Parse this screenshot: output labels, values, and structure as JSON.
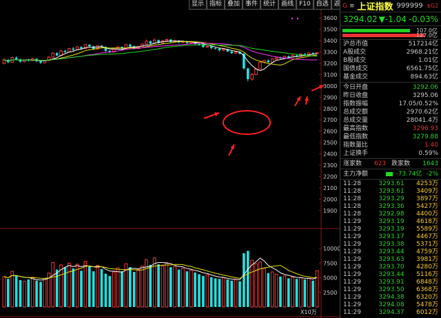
{
  "toolbar": {
    "items": [
      "显示",
      "指标",
      "叠加",
      "事件",
      "统计",
      "画线",
      "F10",
      "自选",
      "返回"
    ]
  },
  "chart": {
    "price_ticks": [
      "3600",
      "3500",
      "3400",
      "3300",
      "3200",
      "3100",
      "3000",
      "2900",
      "2800",
      "2700",
      "2600",
      "2500",
      "2400",
      "2300",
      "2200",
      "2100",
      "2000",
      "1900"
    ],
    "volume_ticks": [
      "10000",
      "7500",
      "5000",
      "2500"
    ],
    "volume_unit": "X10万"
  },
  "chart_data": {
    "type": "candlestick",
    "ylim": [
      1850,
      3650
    ],
    "candles": [
      {
        "o": 3200,
        "c": 3230,
        "h": 3245,
        "l": 3190
      },
      {
        "o": 3230,
        "c": 3210,
        "h": 3240,
        "l": 3200
      },
      {
        "o": 3210,
        "c": 3250,
        "h": 3260,
        "l": 3205
      },
      {
        "o": 3250,
        "c": 3235,
        "h": 3262,
        "l": 3225
      },
      {
        "o": 3235,
        "c": 3215,
        "h": 3240,
        "l": 3205
      },
      {
        "o": 3215,
        "c": 3230,
        "h": 3235,
        "l": 3208
      },
      {
        "o": 3230,
        "c": 3225,
        "h": 3238,
        "l": 3215
      },
      {
        "o": 3225,
        "c": 3240,
        "h": 3248,
        "l": 3218
      },
      {
        "o": 3240,
        "c": 3220,
        "h": 3245,
        "l": 3210
      },
      {
        "o": 3220,
        "c": 3205,
        "h": 3228,
        "l": 3195
      },
      {
        "o": 3205,
        "c": 3225,
        "h": 3232,
        "l": 3198
      },
      {
        "o": 3225,
        "c": 3255,
        "h": 3262,
        "l": 3220
      },
      {
        "o": 3255,
        "c": 3290,
        "h": 3300,
        "l": 3250
      },
      {
        "o": 3290,
        "c": 3270,
        "h": 3298,
        "l": 3262
      },
      {
        "o": 3270,
        "c": 3310,
        "h": 3318,
        "l": 3265
      },
      {
        "o": 3310,
        "c": 3300,
        "h": 3320,
        "l": 3292
      },
      {
        "o": 3300,
        "c": 3330,
        "h": 3338,
        "l": 3295
      },
      {
        "o": 3330,
        "c": 3320,
        "h": 3345,
        "l": 3310
      },
      {
        "o": 3320,
        "c": 3345,
        "h": 3352,
        "l": 3315
      },
      {
        "o": 3345,
        "c": 3330,
        "h": 3350,
        "l": 3320
      },
      {
        "o": 3330,
        "c": 3365,
        "h": 3372,
        "l": 3326
      },
      {
        "o": 3365,
        "c": 3350,
        "h": 3370,
        "l": 3340
      },
      {
        "o": 3350,
        "c": 3325,
        "h": 3355,
        "l": 3318
      },
      {
        "o": 3325,
        "c": 3355,
        "h": 3360,
        "l": 3320
      },
      {
        "o": 3355,
        "c": 3345,
        "h": 3362,
        "l": 3335
      },
      {
        "o": 3345,
        "c": 3310,
        "h": 3350,
        "l": 3300
      },
      {
        "o": 3310,
        "c": 3300,
        "h": 3318,
        "l": 3290
      },
      {
        "o": 3300,
        "c": 3325,
        "h": 3330,
        "l": 3295
      },
      {
        "o": 3325,
        "c": 3345,
        "h": 3352,
        "l": 3320
      },
      {
        "o": 3345,
        "c": 3330,
        "h": 3350,
        "l": 3322
      },
      {
        "o": 3330,
        "c": 3365,
        "h": 3372,
        "l": 3325
      },
      {
        "o": 3365,
        "c": 3350,
        "h": 3375,
        "l": 3340
      },
      {
        "o": 3350,
        "c": 3330,
        "h": 3358,
        "l": 3322
      },
      {
        "o": 3330,
        "c": 3350,
        "h": 3356,
        "l": 3325
      },
      {
        "o": 3350,
        "c": 3370,
        "h": 3378,
        "l": 3345
      },
      {
        "o": 3370,
        "c": 3395,
        "h": 3410,
        "l": 3365
      },
      {
        "o": 3395,
        "c": 3375,
        "h": 3402,
        "l": 3368
      },
      {
        "o": 3375,
        "c": 3405,
        "h": 3420,
        "l": 3370
      },
      {
        "o": 3405,
        "c": 3380,
        "h": 3410,
        "l": 3372
      },
      {
        "o": 3380,
        "c": 3400,
        "h": 3408,
        "l": 3375
      },
      {
        "o": 3400,
        "c": 3410,
        "h": 3418,
        "l": 3392
      },
      {
        "o": 3410,
        "c": 3390,
        "h": 3415,
        "l": 3380
      },
      {
        "o": 3390,
        "c": 3400,
        "h": 3408,
        "l": 3385
      },
      {
        "o": 3400,
        "c": 3385,
        "h": 3405,
        "l": 3375
      },
      {
        "o": 3385,
        "c": 3395,
        "h": 3400,
        "l": 3378
      },
      {
        "o": 3395,
        "c": 3380,
        "h": 3400,
        "l": 3370
      },
      {
        "o": 3380,
        "c": 3390,
        "h": 3395,
        "l": 3372
      },
      {
        "o": 3390,
        "c": 3370,
        "h": 3395,
        "l": 3362
      },
      {
        "o": 3370,
        "c": 3365,
        "h": 3378,
        "l": 3355
      },
      {
        "o": 3365,
        "c": 3345,
        "h": 3370,
        "l": 3335
      },
      {
        "o": 3345,
        "c": 3350,
        "h": 3355,
        "l": 3338
      },
      {
        "o": 3350,
        "c": 3335,
        "h": 3355,
        "l": 3325
      },
      {
        "o": 3335,
        "c": 3330,
        "h": 3340,
        "l": 3320
      },
      {
        "o": 3330,
        "c": 3315,
        "h": 3335,
        "l": 3305
      },
      {
        "o": 3315,
        "c": 3325,
        "h": 3330,
        "l": 3308
      },
      {
        "o": 3325,
        "c": 3305,
        "h": 3330,
        "l": 3298
      },
      {
        "o": 3305,
        "c": 3290,
        "h": 3310,
        "l": 3282
      },
      {
        "o": 3290,
        "c": 3300,
        "h": 3306,
        "l": 3285
      },
      {
        "o": 3300,
        "c": 3285,
        "h": 3305,
        "l": 3278
      },
      {
        "o": 3285,
        "c": 3155,
        "h": 3290,
        "l": 3145
      },
      {
        "o": 3155,
        "c": 3060,
        "h": 3160,
        "l": 3040
      },
      {
        "o": 3060,
        "c": 3100,
        "h": 3115,
        "l": 3045
      },
      {
        "o": 3100,
        "c": 3150,
        "h": 3160,
        "l": 3095
      },
      {
        "o": 3150,
        "c": 3210,
        "h": 3218,
        "l": 3145
      },
      {
        "o": 3210,
        "c": 3225,
        "h": 3232,
        "l": 3198
      },
      {
        "o": 3225,
        "c": 3210,
        "h": 3235,
        "l": 3205
      },
      {
        "o": 3210,
        "c": 3238,
        "h": 3245,
        "l": 3205
      },
      {
        "o": 3238,
        "c": 3250,
        "h": 3258,
        "l": 3230
      },
      {
        "o": 3250,
        "c": 3245,
        "h": 3258,
        "l": 3238
      },
      {
        "o": 3245,
        "c": 3262,
        "h": 3268,
        "l": 3240
      },
      {
        "o": 3262,
        "c": 3255,
        "h": 3270,
        "l": 3248
      },
      {
        "o": 3255,
        "c": 3270,
        "h": 3278,
        "l": 3250
      },
      {
        "o": 3270,
        "c": 3262,
        "h": 3280,
        "l": 3255
      },
      {
        "o": 3262,
        "c": 3282,
        "h": 3288,
        "l": 3258
      },
      {
        "o": 3282,
        "c": 3275,
        "h": 3290,
        "l": 3268
      },
      {
        "o": 3275,
        "c": 3292,
        "h": 3298,
        "l": 3270
      },
      {
        "o": 3292,
        "c": 3285,
        "h": 3298,
        "l": 3280
      },
      {
        "o": 3285,
        "c": 3294,
        "h": 3297,
        "l": 3280
      }
    ],
    "volumes": [
      5200,
      4800,
      6100,
      5400,
      4600,
      4400,
      4700,
      5100,
      4500,
      4300,
      4900,
      5800,
      7600,
      6400,
      7200,
      6800,
      7500,
      6600,
      7300,
      6200,
      7800,
      6900,
      6100,
      7100,
      6500,
      5700,
      5300,
      6000,
      6700,
      6100,
      7400,
      6800,
      6000,
      6400,
      7000,
      8100,
      7200,
      8400,
      7300,
      7000,
      7600,
      6800,
      6900,
      6400,
      6600,
      6100,
      6300,
      5900,
      5600,
      5300,
      5500,
      5100,
      4900,
      4800,
      5000,
      4700,
      4500,
      4700,
      4400,
      9200,
      9600,
      8000,
      7400,
      7700,
      6600,
      5800,
      6000,
      5600,
      5200,
      5300,
      4900,
      5100,
      4800,
      5000,
      4700,
      4900,
      4500,
      6200
    ]
  },
  "quote": {
    "market_tag": "G",
    "menu_icon": "≡",
    "name": "上证指数",
    "code": "999999",
    "sg_tag": "$G2",
    "price": "3294.02",
    "change": "▼-1.04",
    "change_pct": "-0.03%",
    "bar1_value": "107.0亿",
    "bar2_value": "127.0亿",
    "stats": [
      {
        "k": "沪总市值",
        "v": "517214亿",
        "color": "#ccc"
      },
      {
        "k": "A股成交",
        "v": "2968.21亿",
        "color": "#ccc"
      },
      {
        "k": "B股成交",
        "v": "1.01亿",
        "color": "#ccc"
      },
      {
        "k": "国债成交",
        "v": "6561.75亿",
        "color": "#ccc"
      },
      {
        "k": "基金成交",
        "v": "894.63亿",
        "color": "#ccc"
      }
    ],
    "stats2": [
      {
        "k": "今日开盘",
        "v": "3292.06",
        "color": "#2d2"
      },
      {
        "k": "昨日收盘",
        "v": "3295.06",
        "color": "#ccc"
      },
      {
        "k": "指数振幅",
        "v": "17.05/0.52%",
        "color": "#ccc"
      },
      {
        "k": "总成交额",
        "v": "2970.62亿",
        "color": "#ccc"
      },
      {
        "k": "总成交量",
        "v": "28041.4万",
        "color": "#ccc"
      },
      {
        "k": "最高指数",
        "v": "3296.93",
        "color": "#e33"
      },
      {
        "k": "最低指数",
        "v": "3279.88",
        "color": "#2d2"
      },
      {
        "k": "指数量比",
        "v": "1.40",
        "color": "#e33"
      },
      {
        "k": "上证换手",
        "v": "0.59%",
        "color": "#ccc"
      }
    ],
    "rise_label": "涨家数",
    "rise_count": "623",
    "fall_label": "跌家数",
    "fall_count": "1643",
    "net_label": "主力净额",
    "net_value": "-73.74亿",
    "net_pct": "-2%",
    "ticks": [
      {
        "t": "11:28",
        "p": "3293.61",
        "v": "4253万"
      },
      {
        "t": "11:28",
        "p": "3293.61",
        "v": "3409万"
      },
      {
        "t": "11:28",
        "p": "3293.29",
        "v": "3897万"
      },
      {
        "t": "11:28",
        "p": "3293.36",
        "v": "5427万"
      },
      {
        "t": "11:28",
        "p": "3292.98",
        "v": "4400万"
      },
      {
        "t": "11:29",
        "p": "3293.19",
        "v": "4618万"
      },
      {
        "t": "11:29",
        "p": "3293.19",
        "v": "5589万"
      },
      {
        "t": "11:29",
        "p": "3293.17",
        "v": "4467万"
      },
      {
        "t": "11:29",
        "p": "3293.38",
        "v": "5371万"
      },
      {
        "t": "11:29",
        "p": "3293.44",
        "v": "4759万"
      },
      {
        "t": "11:29",
        "p": "3293.63",
        "v": "3981万"
      },
      {
        "t": "11:29",
        "p": "3293.70",
        "v": "4280万"
      },
      {
        "t": "11:29",
        "p": "3293.44",
        "v": "5116万"
      },
      {
        "t": "11:29",
        "p": "3293.91",
        "v": "6848万"
      },
      {
        "t": "11:29",
        "p": "3293.50",
        "v": "6368万"
      },
      {
        "t": "11:29",
        "p": "3294.38",
        "v": "6320万"
      },
      {
        "t": "11:29",
        "p": "3294.08",
        "v": "5478万"
      },
      {
        "t": "11:29",
        "p": "3294.37",
        "v": "6012万"
      }
    ]
  }
}
